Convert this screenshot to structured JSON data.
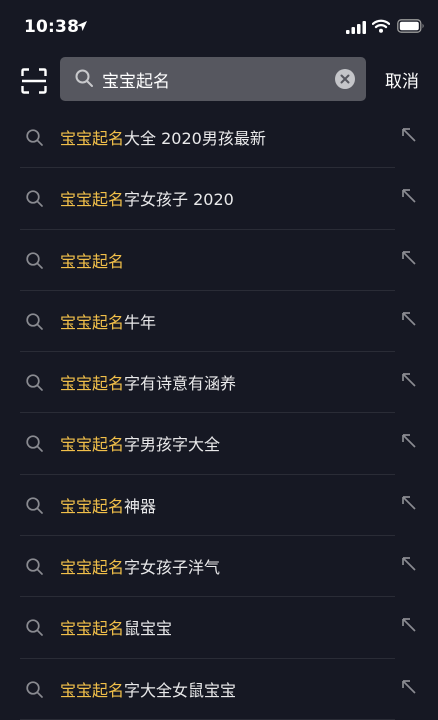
{
  "status_bar": {
    "time": "10:38"
  },
  "search": {
    "query": "宝宝起名",
    "cancel_label": "取消"
  },
  "suggestions": [
    {
      "match": "宝宝起名",
      "rest": "大全 2020男孩最新"
    },
    {
      "match": "宝宝起名",
      "rest": "字女孩子 2020"
    },
    {
      "match": "宝宝起名",
      "rest": ""
    },
    {
      "match": "宝宝起名",
      "rest": "牛年"
    },
    {
      "match": "宝宝起名",
      "rest": "字有诗意有涵养"
    },
    {
      "match": "宝宝起名",
      "rest": "字男孩字大全"
    },
    {
      "match": "宝宝起名",
      "rest": "神器"
    },
    {
      "match": "宝宝起名",
      "rest": "字女孩子洋气"
    },
    {
      "match": "宝宝起名",
      "rest": "鼠宝宝"
    },
    {
      "match": "宝宝起名",
      "rest": "字大全女鼠宝宝"
    }
  ],
  "colors": {
    "background": "#161823",
    "highlight": "#f2c04a",
    "search_box": "#56575f"
  },
  "icons": [
    "location-arrow-icon",
    "signal-icon",
    "wifi-icon",
    "battery-icon",
    "scan-icon",
    "search-icon",
    "clear-icon",
    "fill-arrow-icon"
  ]
}
